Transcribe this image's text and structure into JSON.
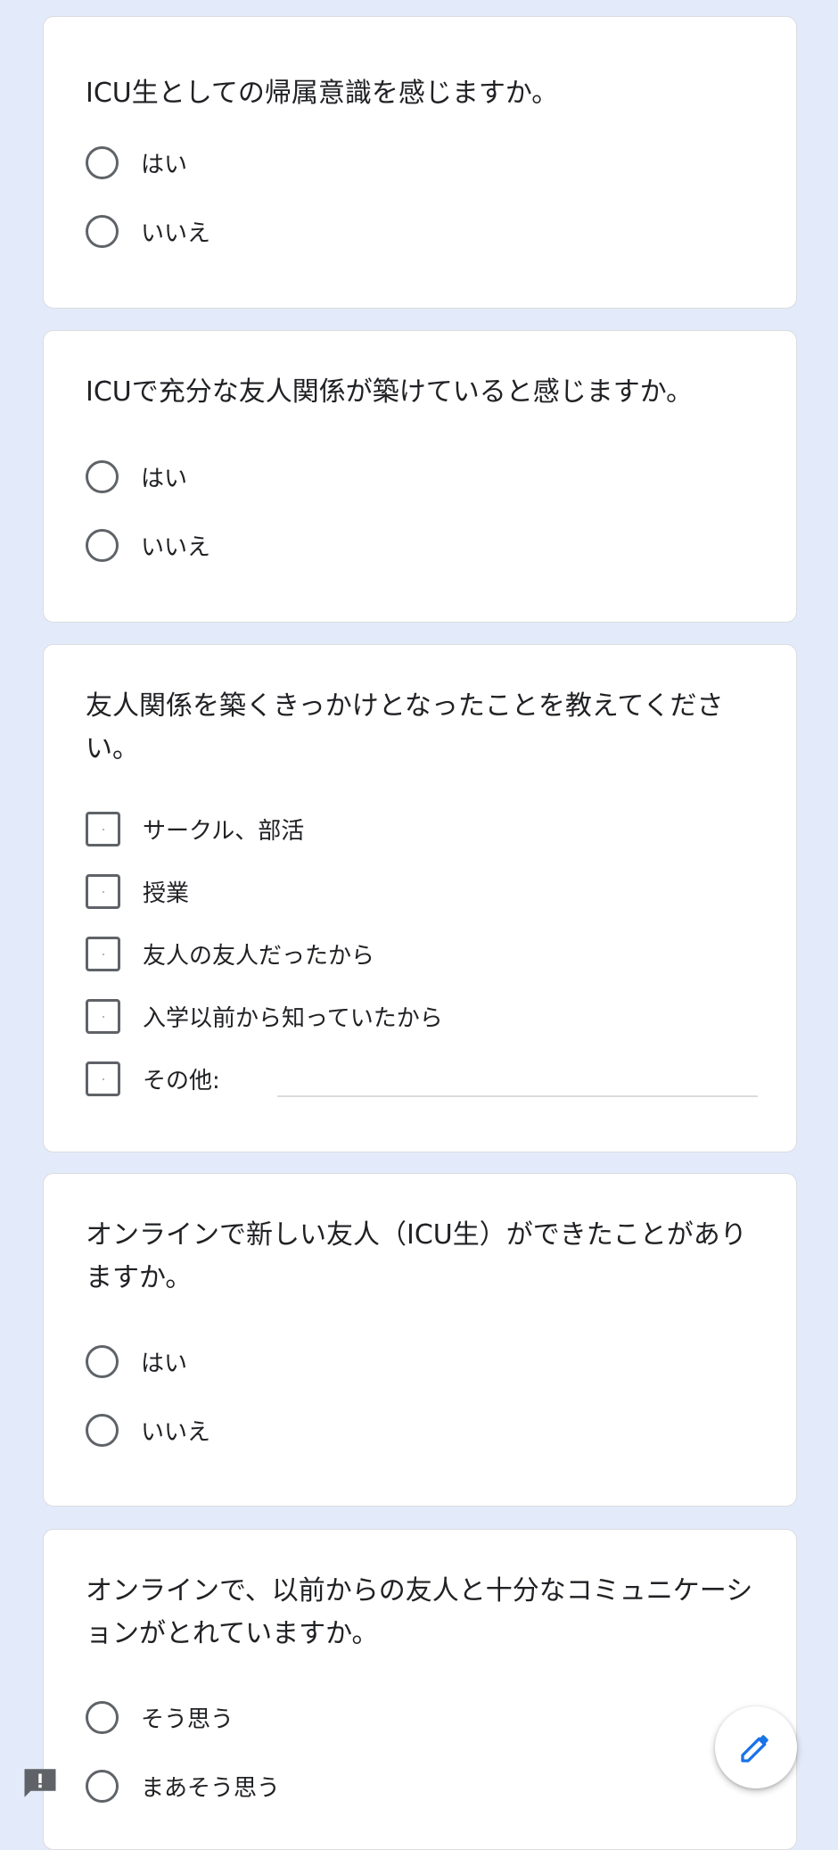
{
  "questions": [
    {
      "title": "ICU生としての帰属意識を感じますか。",
      "type": "radio",
      "options": [
        "はい",
        "いいえ"
      ]
    },
    {
      "title": "ICUで充分な友人関係が築けていると感じますか。",
      "type": "radio",
      "options": [
        "はい",
        "いいえ"
      ]
    },
    {
      "title": "友人関係を築くきっかけとなったことを教えてください。",
      "type": "checkbox",
      "options": [
        "サークル、部活",
        "授業",
        "友人の友人だったから",
        "入学以前から知っていたから",
        "その他:"
      ]
    },
    {
      "title": "オンラインで新しい友人（ICU生）ができたことがありますか。",
      "type": "radio",
      "options": [
        "はい",
        "いいえ"
      ]
    },
    {
      "title": "オンラインで、以前からの友人と十分なコミュニケーションがとれていますか。",
      "type": "radio",
      "options": [
        "そう思う",
        "まあそう思う"
      ]
    }
  ],
  "icons": {
    "fab": "pencil-icon",
    "feedback": "feedback-icon"
  },
  "colors": {
    "background": "#e3ebfa",
    "accent": "#1a73e8"
  }
}
